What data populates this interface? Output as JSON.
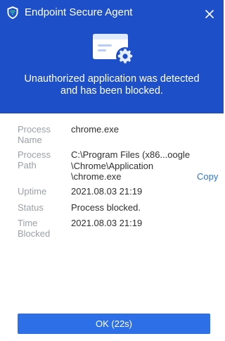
{
  "window": {
    "title": "Endpoint Secure Agent",
    "logo_icon": "shield-logo-icon",
    "close_icon": "close-icon"
  },
  "banner": {
    "icon": "blocked-application-settings-icon",
    "message_line1": "Unauthorized application was detected",
    "message_line2": "and has been blocked."
  },
  "details": [
    {
      "label_line1": "Process",
      "label_line2": "Name",
      "value_lines": [
        "chrome.exe"
      ]
    },
    {
      "label_line1": "Process",
      "label_line2": "Path",
      "value_lines": [
        "C:\\Program Files (x86...oogle",
        "\\Chrome\\Application",
        "\\chrome.exe"
      ]
    },
    {
      "label_line1": "Uptime",
      "label_line2": "",
      "value_lines": [
        "2021.08.03 21:19"
      ]
    },
    {
      "label_line1": "Status",
      "label_line2": "",
      "value_lines": [
        "Process blocked."
      ]
    },
    {
      "label_line1": "Time",
      "label_line2": "Blocked",
      "value_lines": [
        "2021.08.03 21:19"
      ]
    }
  ],
  "copy_label": "Copy",
  "ok_button_label": "OK (22s)",
  "colors": {
    "header_bg": "#1d4fc9",
    "primary_button": "#2d6fe6",
    "link": "#2f76d4",
    "label_text": "#9aa0a6",
    "value_text": "#2e2e2e"
  }
}
